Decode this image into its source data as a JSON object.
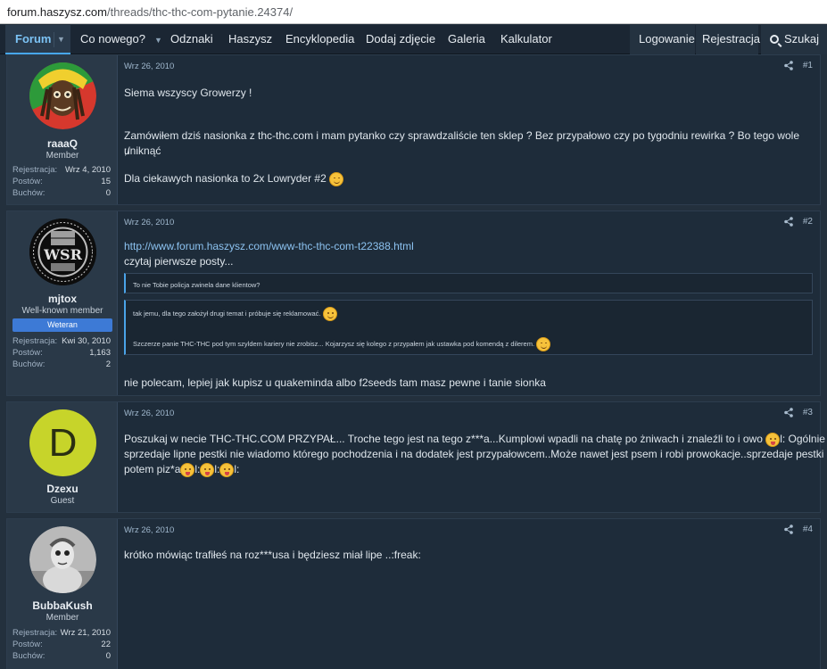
{
  "browser": {
    "url_host": "forum.haszysz.com",
    "url_path": "/threads/thc-thc-com-pytanie.24374/"
  },
  "nav": {
    "forum": "Forum",
    "whats_new": "Co nowego?",
    "badges": "Odznaki",
    "haszysz": "Haszysz",
    "encyclopedia": "Encyklopedia",
    "add_photo": "Dodaj zdjęcie",
    "gallery": "Galeria",
    "calculator": "Kalkulator",
    "login": "Logowanie",
    "register": "Rejestracja",
    "search": "Szukaj"
  },
  "stat_labels": {
    "reg": "Rejestracja:",
    "posts": "Postów:",
    "buchs": "Buchów:"
  },
  "posts": [
    {
      "username": "raaaQ",
      "role": "Member",
      "reg": "Wrz 4, 2010",
      "post_count": "15",
      "buchs": "0",
      "date": "Wrz 26, 2010",
      "number": "#1",
      "line1": "Siema wszyscy Growerzy !",
      "line2": "Zamówiłem dziś nasionka z thc-thc.com i mam pytanko czy sprawdzaliście ten sklep ? Bez przypałowo czy po tygodniu rewirka ? Bo tego wole uniknąć",
      "line3": ";/",
      "line4": "Dla ciekawych nasionka to 2x Lowryder #2"
    },
    {
      "username": "mjtox",
      "role": "Well-known member",
      "badge": "Weteran",
      "reg": "Kwi 30, 2010",
      "post_count": "1,163",
      "buchs": "2",
      "date": "Wrz 26, 2010",
      "number": "#2",
      "link": "http://www.forum.haszysz.com/www-thc-thc-com-t22388.html",
      "line1": "czytaj pierwsze posty...",
      "quote1": "To nie Tobie policja zwinela dane klientow?",
      "quote2a": "tak jemu, dla tego założył drugi temat i próbuje się reklamować.",
      "quote2b": "Szczerze panie THC-THC pod tym szyldem kariery nie zrobisz... Kojarzysz się kolego z przypałem jak ustawka pod komendą z dilerem.",
      "line2": "nie polecam, lepiej jak kupisz u quakeminda albo f2seeds tam masz pewne i tanie sionka"
    },
    {
      "username": "Dzexu",
      "role": "Guest",
      "avatar_letter": "D",
      "date": "Wrz 26, 2010",
      "number": "#3",
      "line1a": "Poszukaj w necie THC-THC.COM PRZYPAŁ... Troche tego jest na tego z***a...Kumplowi wpadli na chatę po żniwach i znaleźli to i owo",
      "line1b": "l: Ogólnie gość",
      "line2": "sprzedaje lipne pestki nie wiadomo którego pochodzenia i na dodatek jest przypałowcem..Może nawet jest psem i robi prowokacje..sprzedaje pestki a",
      "line3a": "potem piz*a",
      "sep": "l:",
      "line3end": "l:"
    },
    {
      "username": "BubbaKush",
      "role": "Member",
      "reg": "Wrz 21, 2010",
      "post_count": "22",
      "buchs": "0",
      "date": "Wrz 26, 2010",
      "number": "#4",
      "line1": "krótko mówiąc trafiłeś na roz***usa i będziesz miał lipe ..:freak:"
    }
  ],
  "colors": {
    "accent": "#47a7eb",
    "badge": "#3d7ad6",
    "bg": "#23303d"
  }
}
